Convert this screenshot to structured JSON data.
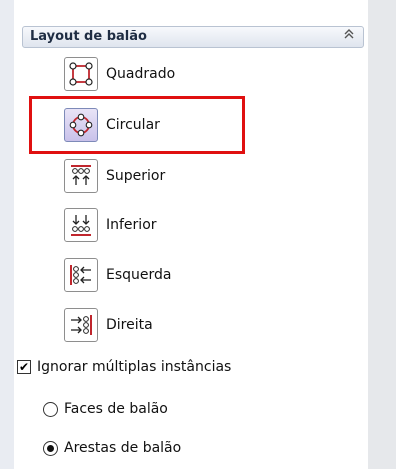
{
  "panel": {
    "title": "Layout de balão",
    "collapse_icon": "double-chevron-up-icon"
  },
  "layout_options": [
    {
      "label": "Quadrado",
      "icon": "square-layout-icon",
      "selected": false
    },
    {
      "label": "Circular",
      "icon": "circular-layout-icon",
      "selected": true
    },
    {
      "label": "Superior",
      "icon": "top-layout-icon",
      "selected": false
    },
    {
      "label": "Inferior",
      "icon": "bottom-layout-icon",
      "selected": false
    },
    {
      "label": "Esquerda",
      "icon": "left-layout-icon",
      "selected": false
    },
    {
      "label": "Direita",
      "icon": "right-layout-icon",
      "selected": false
    }
  ],
  "ignore_multiple": {
    "label": "Ignorar múltiplas instâncias",
    "checked": true
  },
  "balloon_mode": [
    {
      "label": "Faces de balão",
      "selected": false
    },
    {
      "label": "Arestas de balão",
      "selected": true
    }
  ],
  "colors": {
    "highlight": "#e01010",
    "selected_icon_bg": "#c9c1ea"
  }
}
